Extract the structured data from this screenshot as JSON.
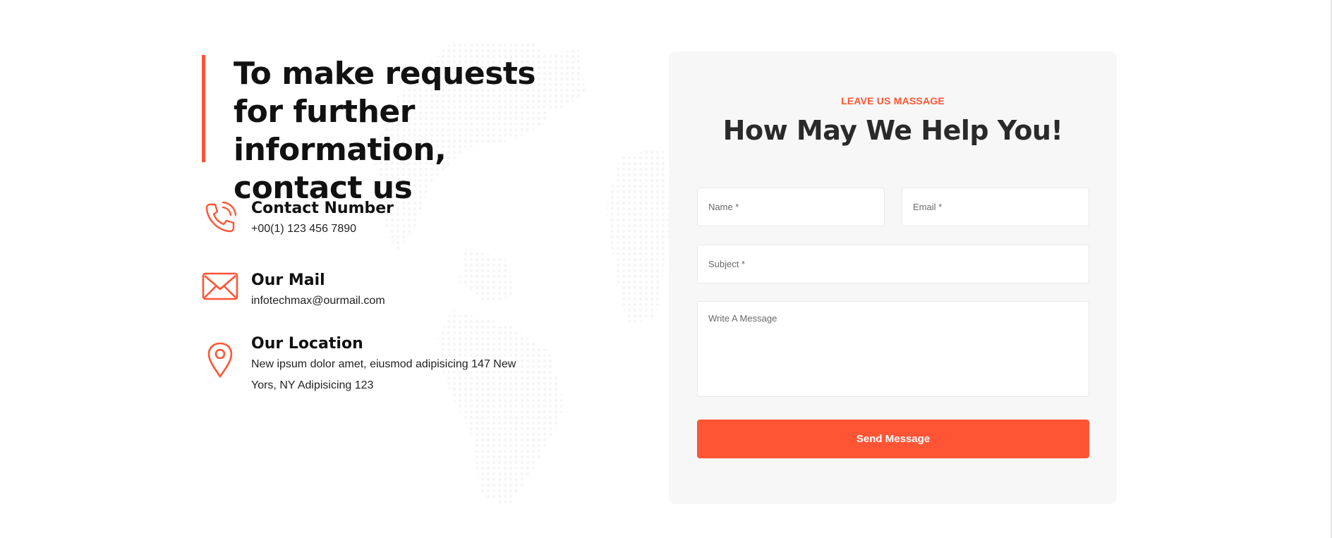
{
  "intro": {
    "heading": "To make requests for further information, contact us"
  },
  "contact_info": {
    "phone": {
      "title": "Contact Number",
      "text": "+00(1) 123 456 7890",
      "icon": "phone-ringing-icon"
    },
    "mail": {
      "title": "Our Mail",
      "text": "infotechmax@ourmail.com",
      "icon": "envelope-icon"
    },
    "location": {
      "title": "Our Location",
      "text": "New ipsum dolor amet, eiusmod adipisicing 147 New Yors, NY Adipisicing 123",
      "icon": "map-pin-icon"
    }
  },
  "form": {
    "eyebrow": "LEAVE US MASSAGE",
    "title": "How May We Help You!",
    "name_placeholder": "Name *",
    "email_placeholder": "Email *",
    "subject_placeholder": "Subject *",
    "message_placeholder": "Write A Message",
    "submit_label": "Send Message"
  },
  "colors": {
    "accent": "#ff5535",
    "heading": "#111111",
    "card_bg": "#f7f7f7"
  }
}
